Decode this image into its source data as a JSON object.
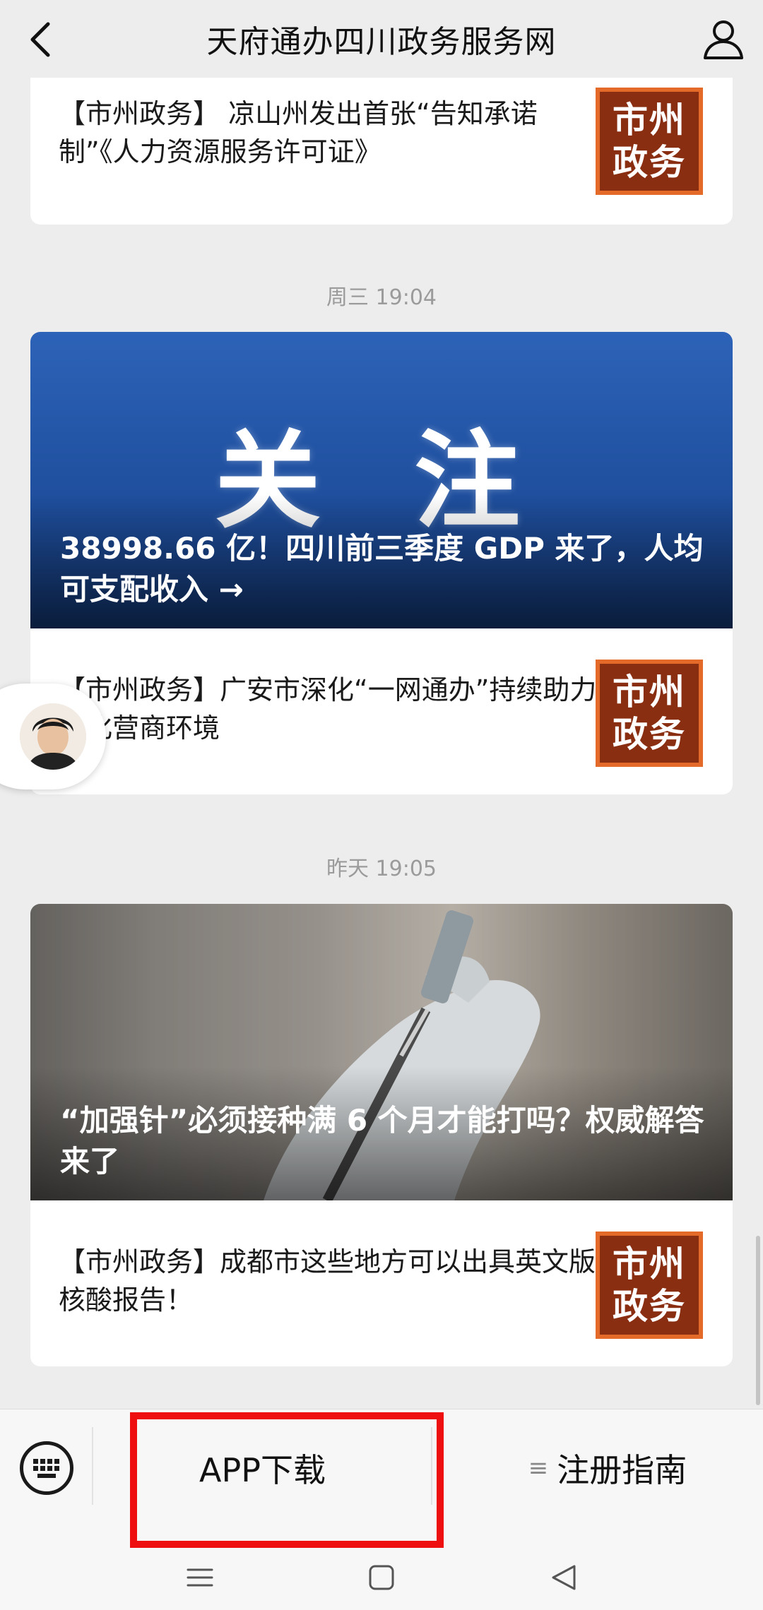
{
  "header": {
    "title": "天府通办四川政务服务网"
  },
  "feed": [
    {
      "type": "article",
      "text": "【市州政务】 凉山州发出首张“告知承诺制”《人力资源服务许可证》",
      "badge": [
        "市州",
        "政务"
      ]
    },
    {
      "type": "timestamp",
      "text": "周三 19:04"
    },
    {
      "type": "hero",
      "big_text": "关 注",
      "caption": "38998.66 亿！四川前三季度 GDP 来了，人均可支配收入 →"
    },
    {
      "type": "article",
      "text": "【市州政务】广安市深化“一网通办”持续助力优化营商环境",
      "badge": [
        "市州",
        "政务"
      ]
    },
    {
      "type": "timestamp",
      "text": "昨天 19:05"
    },
    {
      "type": "hero",
      "caption": "“加强针”必须接种满 6 个月才能打吗？权威解答来了"
    },
    {
      "type": "article",
      "text": "【市州政务】成都市这些地方可以出具英文版核酸报告！",
      "badge": [
        "市州",
        "政务"
      ]
    }
  ],
  "bottom_menu": {
    "app_download": "APP下载",
    "guide_icon": "≡",
    "register_guide": "注册指南"
  },
  "icons": {
    "back": "back-icon",
    "profile": "profile-icon",
    "keyboard": "keyboard-icon",
    "nav_menu": "menu-icon",
    "nav_home": "home-icon",
    "nav_back": "back-triangle-icon"
  },
  "colors": {
    "background": "#ededed",
    "badge_bg": "#8a2e12",
    "badge_border": "#e46a2a",
    "highlight": "#ee1010",
    "hero_blue": "#1f4f9e"
  }
}
